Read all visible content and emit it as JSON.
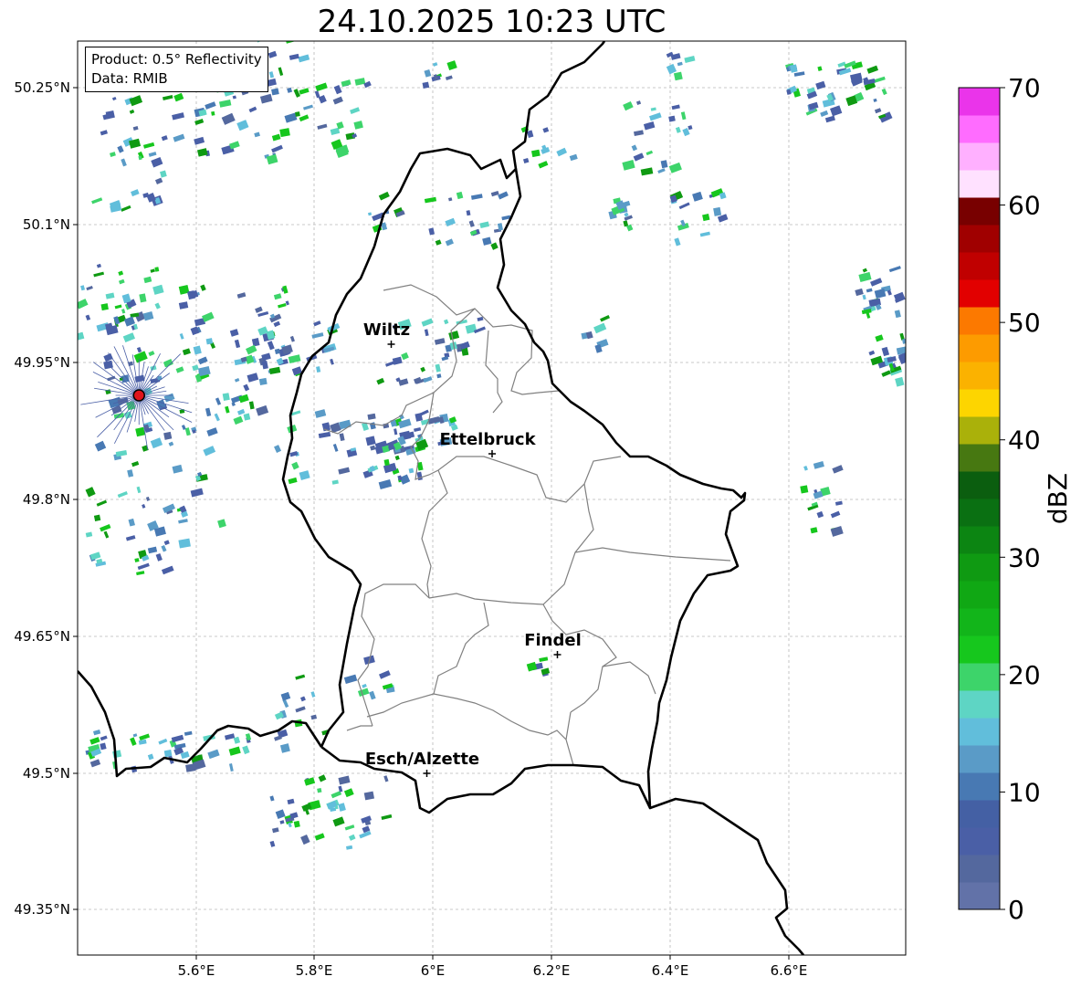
{
  "title": "24.10.2025 10:23 UTC",
  "info": {
    "product": "Product: 0.5° Reflectivity",
    "data": "Data: RMIB"
  },
  "axes": {
    "x_ticks": [
      "5.6°E",
      "5.8°E",
      "6°E",
      "6.2°E",
      "6.4°E",
      "6.6°E"
    ],
    "y_ticks": [
      "50.25°N",
      "50.1°N",
      "49.95°N",
      "49.8°N",
      "49.65°N",
      "49.5°N",
      "49.35°N"
    ]
  },
  "cities": [
    {
      "name": "Wiltz",
      "lon": 5.93,
      "lat": 49.97
    },
    {
      "name": "Ettelbruck",
      "lon": 6.1,
      "lat": 49.85
    },
    {
      "name": "Findel",
      "lon": 6.21,
      "lat": 49.63
    },
    {
      "name": "Esch/Alzette",
      "lon": 5.99,
      "lat": 49.5
    }
  ],
  "radar_site": {
    "lon": 5.505,
    "lat": 49.914
  },
  "colorbar": {
    "label": "dBZ",
    "ticks": [
      "0",
      "10",
      "20",
      "30",
      "40",
      "50",
      "60",
      "70"
    ],
    "colors": [
      "#6272a8",
      "#54689e",
      "#4a5fa6",
      "#4460a4",
      "#4879b3",
      "#5a9bc7",
      "#61bedb",
      "#5ed5c4",
      "#3dd46a",
      "#16c71d",
      "#12b51a",
      "#10a814",
      "#0f9a12",
      "#0c8512",
      "#0a7012",
      "#0b5e0f",
      "#477811",
      "#aab10a",
      "#fdd500",
      "#fbb200",
      "#fd9b00",
      "#fc7900",
      "#e20000",
      "#c00000",
      "#a00000",
      "#780000",
      "#ffe1ff",
      "#ffb0ff",
      "#ff6cff",
      "#ea34ea"
    ]
  }
}
